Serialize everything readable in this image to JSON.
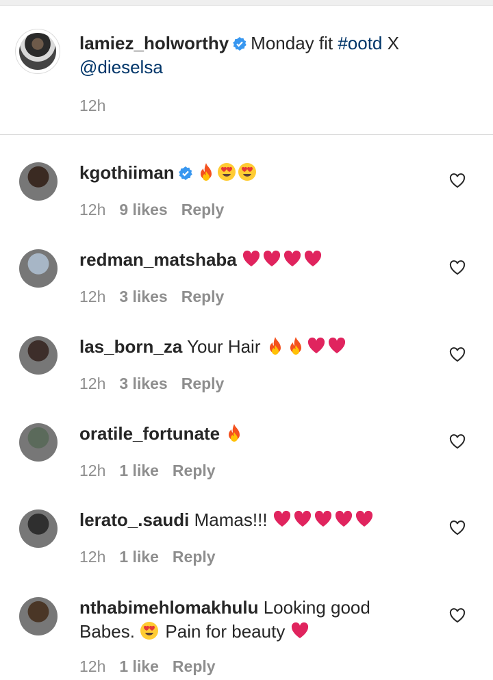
{
  "caption": {
    "username": "lamiez_holworthy",
    "text": "Monday fit ",
    "hashtag": "#ootd",
    "text_after": " X",
    "mention": "@dieselsa",
    "time": "12h"
  },
  "comments": [
    {
      "username": "kgothiiman",
      "verified": true,
      "text": "",
      "emojis": [
        "fire",
        "heart-eyes",
        "heart-eyes"
      ],
      "time": "12h",
      "likes": "9 likes",
      "reply": "Reply",
      "avatar_color": "#3a2a22"
    },
    {
      "username": "redman_matshaba",
      "verified": false,
      "text": "",
      "emojis": [
        "heart",
        "heart",
        "heart",
        "heart"
      ],
      "time": "12h",
      "likes": "3 likes",
      "reply": "Reply",
      "avatar_color": "#a7b6c6"
    },
    {
      "username": "las_born_za",
      "verified": false,
      "text": "Your Hair",
      "emojis": [
        "fire",
        "fire",
        "heart",
        "heart"
      ],
      "time": "12h",
      "likes": "3 likes",
      "reply": "Reply",
      "avatar_color": "#3d2e2a"
    },
    {
      "username": "oratile_fortunate",
      "verified": false,
      "text": "",
      "emojis": [
        "fire"
      ],
      "time": "12h",
      "likes": "1 like",
      "reply": "Reply",
      "avatar_color": "#5b6a5b"
    },
    {
      "username": "lerato_.saudi",
      "verified": false,
      "text": "Mamas!!!",
      "emojis": [
        "heart",
        "heart",
        "heart",
        "heart",
        "heart"
      ],
      "time": "12h",
      "likes": "1 like",
      "reply": "Reply",
      "avatar_color": "#2f2f2f"
    },
    {
      "username": "nthabimehlomakhulu",
      "verified": false,
      "text": "Looking good",
      "text_line2": "Babes.",
      "text_line2_after": "Pain for beauty",
      "emojis": [],
      "time": "12h",
      "likes": "1 like",
      "reply": "Reply",
      "avatar_color": "#4a3626"
    }
  ],
  "colors": {
    "link": "#003569",
    "meta": "#8e8e8e",
    "verified": "#3897f0",
    "heart": "#e0245e"
  }
}
